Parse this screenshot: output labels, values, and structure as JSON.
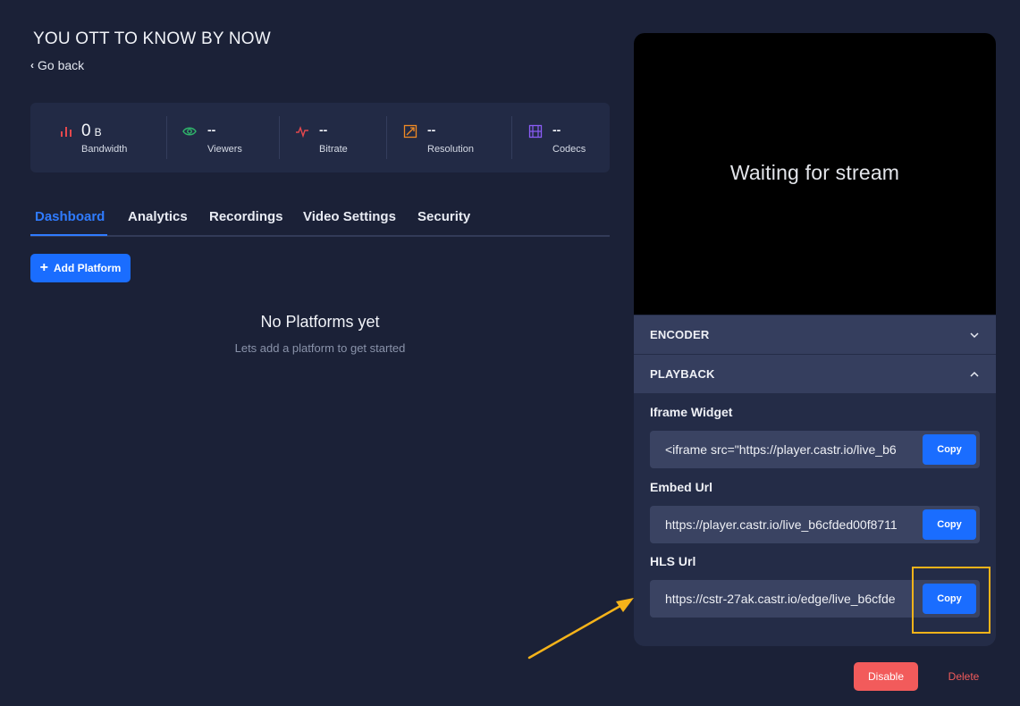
{
  "header": {
    "title": "YOU OTT TO KNOW BY NOW",
    "back_label": "Go back"
  },
  "stats": [
    {
      "label": "Bandwidth",
      "value": "0",
      "unit": "B",
      "icon": "bar-chart-icon",
      "color": "#e5484d"
    },
    {
      "label": "Viewers",
      "value": "--",
      "icon": "eye-icon",
      "color": "#2fb36a"
    },
    {
      "label": "Bitrate",
      "value": "--",
      "icon": "pulse-icon",
      "color": "#e5484d"
    },
    {
      "label": "Resolution",
      "value": "--",
      "icon": "resize-icon",
      "color": "#f08a24"
    },
    {
      "label": "Codecs",
      "value": "--",
      "icon": "film-icon",
      "color": "#8b5cf6"
    }
  ],
  "tabs": [
    {
      "label": "Dashboard",
      "active": true
    },
    {
      "label": "Analytics"
    },
    {
      "label": "Recordings"
    },
    {
      "label": "Video Settings"
    },
    {
      "label": "Security"
    }
  ],
  "actions": {
    "add_platform_label": "Add Platform"
  },
  "empty_state": {
    "title": "No Platforms yet",
    "subtitle": "Lets add a platform to get started"
  },
  "player": {
    "message": "Waiting for stream"
  },
  "accordions": {
    "encoder": {
      "title": "ENCODER",
      "expanded": false
    },
    "playback": {
      "title": "PLAYBACK",
      "expanded": true
    }
  },
  "playback": {
    "fields": [
      {
        "label": "Iframe Widget",
        "value": "<iframe src=\"https://player.castr.io/live_b6",
        "copy_label": "Copy"
      },
      {
        "label": "Embed Url",
        "value": "https://player.castr.io/live_b6cfded00f8711",
        "copy_label": "Copy"
      },
      {
        "label": "HLS Url",
        "value": "https://cstr-27ak.castr.io/edge/live_b6cfde",
        "copy_label": "Copy"
      }
    ]
  },
  "footer": {
    "disable_label": "Disable",
    "delete_label": "Delete"
  },
  "colors": {
    "accent": "#1a6dff",
    "danger": "#f25b5b",
    "annotation": "#f5b31a",
    "background": "#1b2137"
  }
}
